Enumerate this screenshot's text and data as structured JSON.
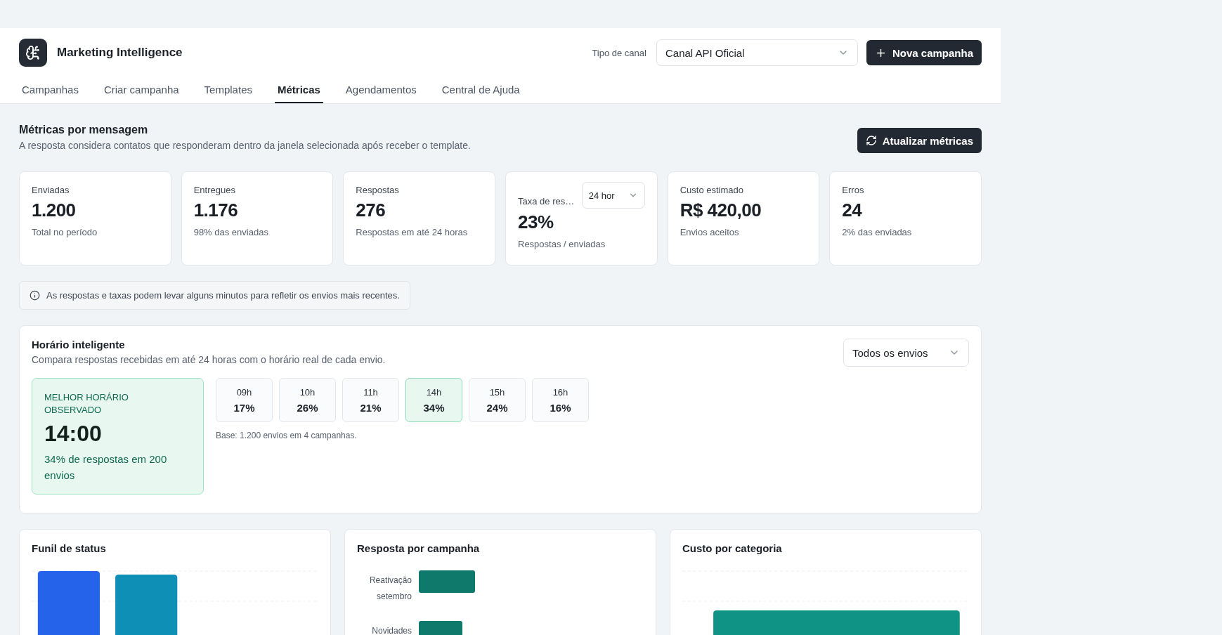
{
  "header": {
    "title": "Marketing Intelligence",
    "channel_label": "Tipo de canal",
    "channel_value": "Canal API Oficial",
    "new_button": "Nova campanha"
  },
  "tabs": [
    {
      "label": "Campanhas",
      "selected": false
    },
    {
      "label": "Criar campanha",
      "selected": false
    },
    {
      "label": "Templates",
      "selected": false
    },
    {
      "label": "Métricas",
      "selected": true
    },
    {
      "label": "Agendamentos",
      "selected": false
    },
    {
      "label": "Central de Ajuda",
      "selected": false
    }
  ],
  "section": {
    "title": "Métricas por mensagem",
    "subtitle": "A resposta considera contatos que responderam dentro da janela selecionada após receber o template.",
    "refresh_button": "Atualizar métricas"
  },
  "metrics": [
    {
      "kind": "plain",
      "label": "Enviadas",
      "value": "1.200",
      "note": "Total no período"
    },
    {
      "kind": "plain",
      "label": "Entregues",
      "value": "1.176",
      "note": "98% das enviadas"
    },
    {
      "kind": "plain",
      "label": "Respostas",
      "value": "276",
      "note": "Respostas em até 24 horas"
    },
    {
      "kind": "select",
      "label": "Taxa de res…",
      "select_value": "24 hor",
      "value": "23%",
      "note": "Respostas / enviadas"
    },
    {
      "kind": "plain",
      "label": "Custo estimado",
      "value": "R$ 420,00",
      "note": "Envios aceitos"
    },
    {
      "kind": "plain",
      "label": "Erros",
      "value": "24",
      "note": "2% das enviadas"
    }
  ],
  "info": "As respostas e taxas podem levar alguns minutos para refletir os envios mais recentes.",
  "smart": {
    "title": "Horário inteligente",
    "subtitle": "Compara respostas recebidas em até 24 horas com o horário real de cada envio.",
    "filter": "Todos os envios",
    "best_label": "MELHOR HORÁRIO OBSERVADO",
    "best_time": "14:00",
    "best_note": "34% de respostas em 200 envios",
    "hours": [
      {
        "hour": "09h",
        "rate": "17%",
        "selected": false
      },
      {
        "hour": "10h",
        "rate": "26%",
        "selected": false
      },
      {
        "hour": "11h",
        "rate": "21%",
        "selected": false
      },
      {
        "hour": "14h",
        "rate": "34%",
        "selected": true
      },
      {
        "hour": "15h",
        "rate": "24%",
        "selected": false
      },
      {
        "hour": "16h",
        "rate": "16%",
        "selected": false
      }
    ],
    "base": "Base: 1.200 envios em 4 campanhas."
  },
  "charts": [
    {
      "kind": "funnel",
      "title": "Funil de status"
    },
    {
      "kind": "campaign",
      "title": "Resposta por campanha",
      "labels": [
        "Reativação setembro",
        "Novidades"
      ]
    },
    {
      "kind": "cost",
      "title": "Custo por categoria"
    }
  ]
}
